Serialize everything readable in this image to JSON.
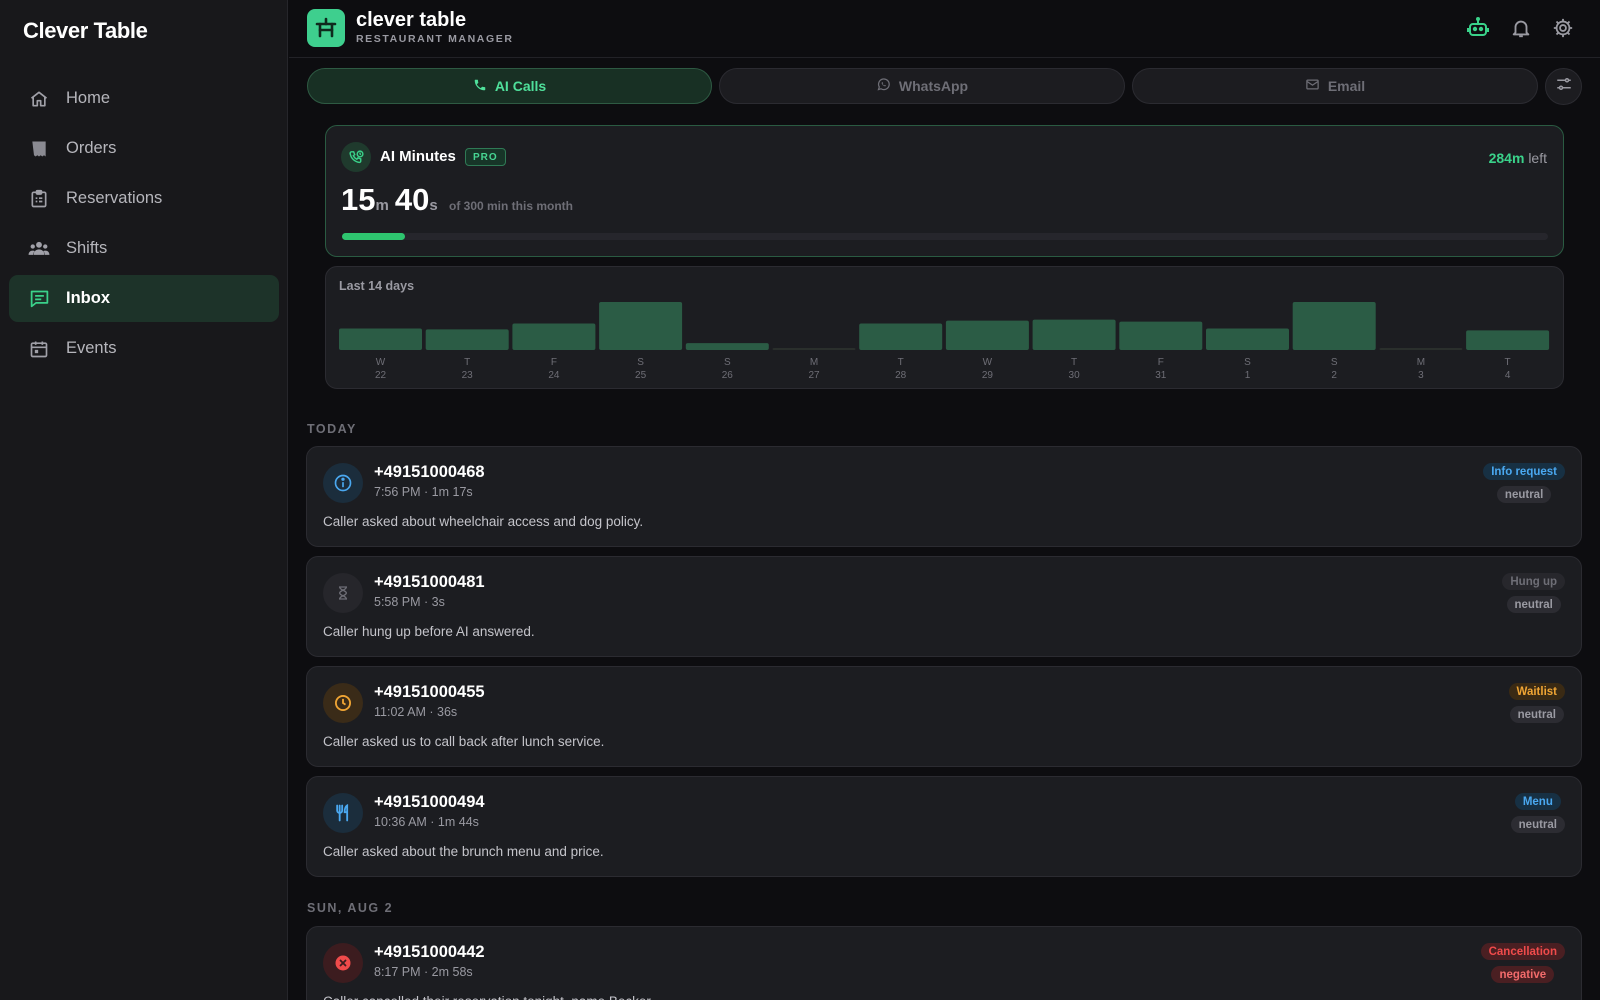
{
  "sidebar": {
    "brand": "Clever Table",
    "items": [
      {
        "label": "Home",
        "icon": "home-icon"
      },
      {
        "label": "Orders",
        "icon": "receipt-icon"
      },
      {
        "label": "Reservations",
        "icon": "clipboard-icon"
      },
      {
        "label": "Shifts",
        "icon": "people-icon"
      },
      {
        "label": "Inbox",
        "icon": "chat-icon",
        "active": true
      },
      {
        "label": "Events",
        "icon": "calendar-icon"
      }
    ]
  },
  "header": {
    "app_name": "clever table",
    "app_subtitle": "RESTAURANT MANAGER",
    "icons": [
      "robot-icon",
      "bell-icon",
      "gear-icon"
    ]
  },
  "tabs": [
    {
      "label": "AI Calls",
      "icon": "phone-icon",
      "active": true
    },
    {
      "label": "WhatsApp",
      "icon": "whatsapp-icon",
      "active": false
    },
    {
      "label": "Email",
      "icon": "mail-icon",
      "active": false
    }
  ],
  "minutes": {
    "title": "AI Minutes",
    "badge": "PRO",
    "left_value": "284m",
    "left_suffix": "left",
    "used_minutes": "15",
    "used_minutes_unit": "m",
    "used_seconds": "40",
    "used_seconds_unit": "s",
    "subtitle": "of 300 min this month",
    "progress_fraction": 0.052
  },
  "chart_data": {
    "type": "bar",
    "title": "Last 14 days",
    "categories": [
      "W",
      "T",
      "F",
      "S",
      "S",
      "M",
      "T",
      "W",
      "T",
      "F",
      "S",
      "S",
      "M",
      "T"
    ],
    "dates": [
      "22",
      "23",
      "24",
      "25",
      "26",
      "27",
      "28",
      "29",
      "30",
      "31",
      "1",
      "2",
      "3",
      "4"
    ],
    "values": [
      22,
      21,
      27,
      49,
      7,
      2,
      27,
      30,
      31,
      29,
      22,
      49,
      2,
      20
    ],
    "ylim": [
      0,
      50
    ]
  },
  "sections": {
    "today": "TODAY",
    "aug2": "SUN, AUG 2"
  },
  "calls": [
    {
      "phone": "+49151000468",
      "meta": "7:56 PM · 1m 17s",
      "summary": "Caller asked about wheelchair access and dog policy.",
      "tag": "Info request",
      "sentiment": "neutral",
      "icon": "info-icon",
      "color": "#4aa8f0",
      "tag_bg": "#173043",
      "icon_bg": "#1b2d3c"
    },
    {
      "phone": "+49151000481",
      "meta": "5:58 PM · 3s",
      "summary": "Caller hung up before AI answered.",
      "tag": "Hung up",
      "sentiment": "neutral",
      "icon": "hourglass-icon",
      "color": "#6e6e76",
      "tag_bg": "#27272c",
      "icon_bg": "#26262b"
    },
    {
      "phone": "+49151000455",
      "meta": "11:02 AM · 36s",
      "summary": "Caller asked us to call back after lunch service.",
      "tag": "Waitlist",
      "sentiment": "neutral",
      "icon": "clock-icon",
      "color": "#f0a534",
      "tag_bg": "#3a2a14",
      "icon_bg": "#3a2b18"
    },
    {
      "phone": "+49151000494",
      "meta": "10:36 AM · 1m 44s",
      "summary": "Caller asked about the brunch menu and price.",
      "tag": "Menu",
      "sentiment": "neutral",
      "icon": "utensils-icon",
      "color": "#4aa8f0",
      "tag_bg": "#173043",
      "icon_bg": "#1b2d3c"
    },
    {
      "phone": "+49151000442",
      "meta": "8:17 PM · 2m 58s",
      "summary": "Caller cancelled their reservation tonight, name Becker.",
      "tag": "Cancellation",
      "sentiment": "negative",
      "icon": "x-circle-icon",
      "color": "#f04b4b",
      "tag_bg": "#4a1f22",
      "icon_bg": "#3c1c1f"
    }
  ]
}
